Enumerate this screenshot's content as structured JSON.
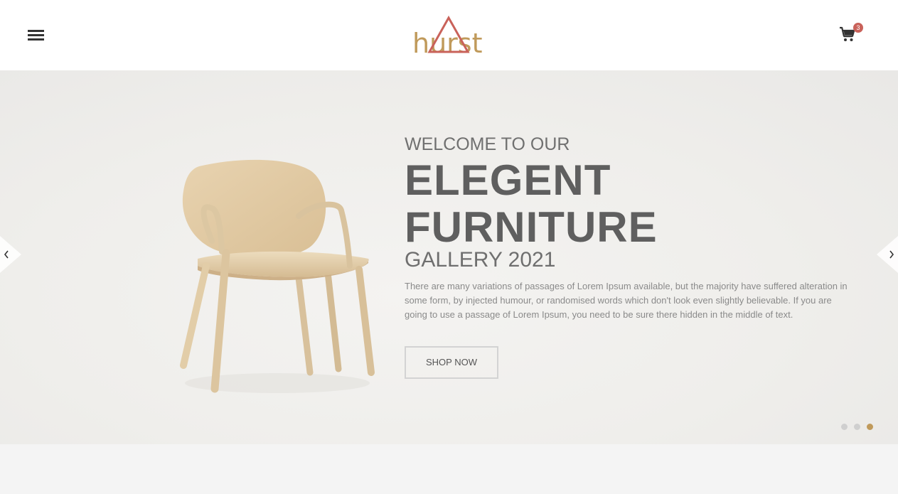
{
  "header": {
    "menu_icon": "hamburger-icon",
    "logo_text": "hurst",
    "logo_mark_color": "#c9625a",
    "logo_text_color": "#c09a5b",
    "cart_icon": "shopping-cart-icon",
    "cart_count": "3"
  },
  "hero": {
    "subtitle": "WELCOME TO OUR",
    "title_line1": "ELEGENT",
    "title_line2": "FURNITURE",
    "tagline": "GALLERY 2021",
    "description": "There are many variations of passages of Lorem Ipsum available, but the majority have suffered alteration in some form, by injected humour, or randomised words which don't look even slightly believable. If you are going to use a passage of Lorem Ipsum, you need to be sure there hidden in the middle of text.",
    "cta_label": "SHOP NOW",
    "prev_icon": "chevron-left-icon",
    "next_icon": "chevron-right-icon",
    "slides": 3,
    "active_slide": 3,
    "accent_color": "#c09a5b"
  }
}
